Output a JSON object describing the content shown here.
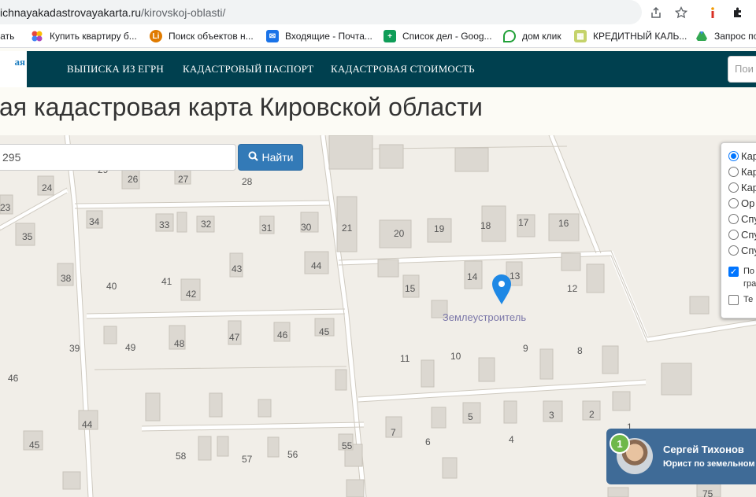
{
  "browser": {
    "url_main": "ichnayakadastrovayakarta.ru",
    "url_path": "/kirovskoj-oblasti/",
    "icons": [
      "share-icon",
      "star-icon",
      "extension-i-icon",
      "puzzle-icon"
    ]
  },
  "bookmarks": [
    {
      "label": "вать",
      "icon": "partial-bookmark-icon",
      "color": "#9aa0a6"
    },
    {
      "label": "Купить квартиру б...",
      "icon": "colorful-dots-icon",
      "color": "#e8453c"
    },
    {
      "label": "Поиск объектов н...",
      "icon": "li-icon",
      "color": "#e07b00"
    },
    {
      "label": "Входящие - Почта...",
      "icon": "mail-icon",
      "color": "#1a73e8"
    },
    {
      "label": "Список дел - Goog...",
      "icon": "plus-doc-icon",
      "color": "#0f9d58"
    },
    {
      "label": "дом клик",
      "icon": "domclick-icon",
      "color": "#21a038"
    },
    {
      "label": "КРЕДИТНЫЙ КАЛЬ...",
      "icon": "sheet-icon",
      "color": "#c5d36b"
    },
    {
      "label": "Запрос пос",
      "icon": "drive-icon",
      "color": "#34a853"
    }
  ],
  "site": {
    "logo_text": "ая",
    "nav": [
      "ВЫПИСКА ИЗ ЕГРН",
      "КАДАСТРОВЫЙ ПАСПОРТ",
      "КАДАСТРОВАЯ СТОИМОСТЬ"
    ],
    "nav_search_placeholder": "Пои",
    "title": "ая кадастровая карта Кировской области"
  },
  "search": {
    "value": "295",
    "button": "Найти"
  },
  "map": {
    "marker_label": "Землеустроитель",
    "house_numbers": [
      "29",
      "26",
      "27",
      "28",
      "24",
      "23",
      "34",
      "33",
      "32",
      "31",
      "30",
      "35",
      "21",
      "20",
      "19",
      "18",
      "17",
      "16",
      "15",
      "14",
      "13",
      "12",
      "43",
      "44",
      "40",
      "41",
      "42",
      "38",
      "39",
      "49",
      "48",
      "47",
      "46",
      "45",
      "11",
      "10",
      "9",
      "8",
      "46",
      "44",
      "45",
      "58",
      "57",
      "56",
      "55",
      "7",
      "6",
      "5",
      "4",
      "3",
      "2",
      "1",
      "75"
    ]
  },
  "layers": {
    "radios": [
      "Кар",
      "Кар",
      "Кар",
      "Ор",
      "Спу",
      "Спу",
      "Спу"
    ],
    "selected_index": 0,
    "checks": [
      {
        "label_line1": "По",
        "label_line2": "гра",
        "checked": true
      },
      {
        "label_line1": "Те",
        "label_line2": "",
        "checked": false
      }
    ]
  },
  "chat": {
    "badge": "1",
    "name": "Сергей Тихонов",
    "role": "Юрист по земельном"
  }
}
